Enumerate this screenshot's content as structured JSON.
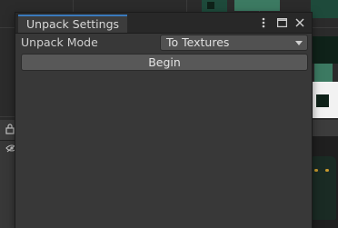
{
  "window": {
    "tab_title": "Unpack Settings"
  },
  "form": {
    "unpack_mode_label": "Unpack Mode",
    "unpack_mode_value": "To Textures",
    "begin_label": "Begin"
  },
  "titlebar_icons": [
    "kebab-menu-icon",
    "maximize-icon",
    "close-icon"
  ],
  "colors": {
    "accent": "#3a79bb",
    "window_bg": "#383838",
    "titlebar_bg": "#282828"
  }
}
